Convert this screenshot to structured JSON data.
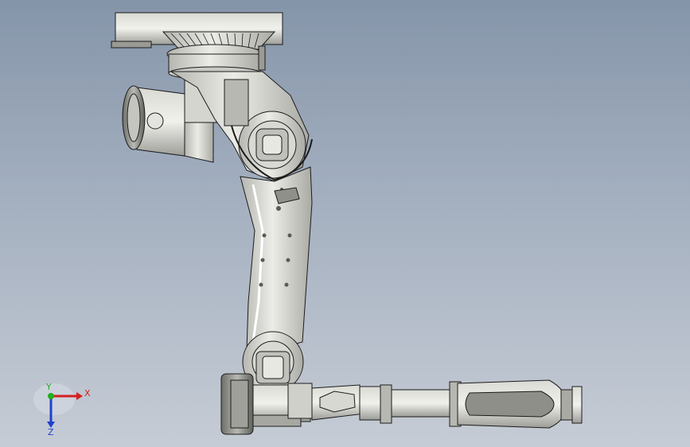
{
  "triad": {
    "x_label": "X",
    "y_label": "Y",
    "z_label": "Z",
    "x_color": "#d42020",
    "y_color": "#20b020",
    "z_color": "#2040d0"
  },
  "colors": {
    "background_top": "#8595a9",
    "background_bottom": "#c6ccd5",
    "metal_light": "#e6e7e2",
    "metal_mid": "#c9cac4",
    "metal_dark": "#8d8e88",
    "outline": "#1c1c1c"
  }
}
